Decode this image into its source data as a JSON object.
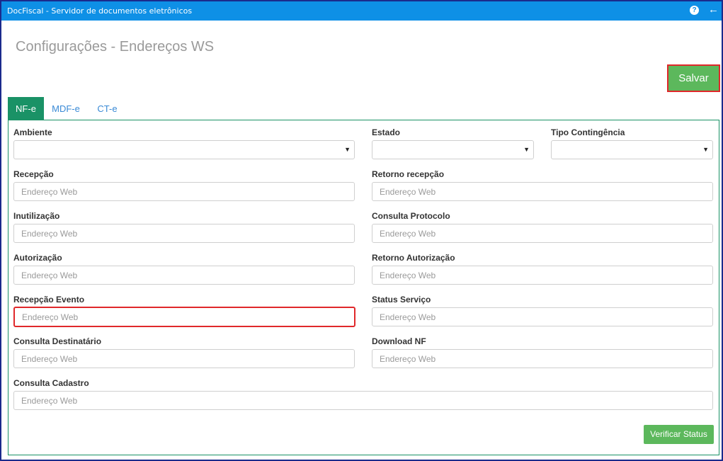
{
  "window": {
    "title": "DocFiscal - Servidor de documentos eletrônicos",
    "help_icon": "?",
    "back_icon": "←"
  },
  "page": {
    "title": "Configurações - Endereços WS"
  },
  "toolbar": {
    "save_label": "Salvar"
  },
  "tabs": [
    {
      "label": "NF-e",
      "active": true
    },
    {
      "label": "MDF-e",
      "active": false
    },
    {
      "label": "CT-e",
      "active": false
    }
  ],
  "form": {
    "ambiente": {
      "label": "Ambiente",
      "value": ""
    },
    "estado": {
      "label": "Estado",
      "value": ""
    },
    "tipo_contingencia": {
      "label": "Tipo Contingência",
      "value": ""
    },
    "recepcao": {
      "label": "Recepção",
      "placeholder": "Endereço Web",
      "value": ""
    },
    "retorno_recepcao": {
      "label": "Retorno recepção",
      "placeholder": "Endereço Web",
      "value": ""
    },
    "inutilizacao": {
      "label": "Inutilização",
      "placeholder": "Endereço Web",
      "value": ""
    },
    "consulta_protocolo": {
      "label": "Consulta Protocolo",
      "placeholder": "Endereço Web",
      "value": ""
    },
    "autorizacao": {
      "label": "Autorização",
      "placeholder": "Endereço Web",
      "value": ""
    },
    "retorno_autorizacao": {
      "label": "Retorno Autorização",
      "placeholder": "Endereço Web",
      "value": ""
    },
    "recepcao_evento": {
      "label": "Recepção Evento",
      "placeholder": "Endereço Web",
      "value": ""
    },
    "status_servico": {
      "label": "Status Serviço",
      "placeholder": "Endereço Web",
      "value": ""
    },
    "consulta_destinatario": {
      "label": "Consulta Destinatário",
      "placeholder": "Endereço Web",
      "value": ""
    },
    "download_nf": {
      "label": "Download NF",
      "placeholder": "Endereço Web",
      "value": ""
    },
    "consulta_cadastro": {
      "label": "Consulta Cadastro",
      "placeholder": "Endereço Web",
      "value": ""
    }
  },
  "actions": {
    "verify_label": "Verificar Status"
  },
  "colors": {
    "titlebar": "#0e90e6",
    "accent_green": "#5cb85c",
    "tab_active": "#1a9266",
    "highlight": "#e0282b",
    "link": "#3a8ad6"
  }
}
